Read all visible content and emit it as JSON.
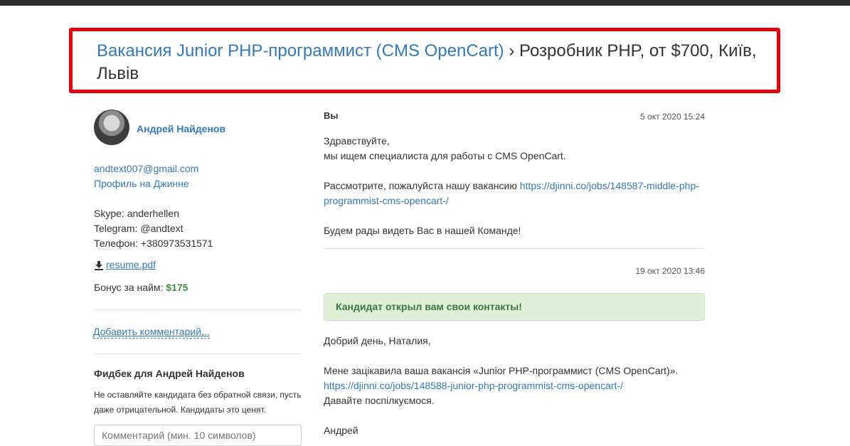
{
  "header": {
    "vacancy_link": "Вакансия Junior PHP-программист (CMS OpenCart)",
    "separator": "›",
    "subtitle": "Розробник PHP, от $700, Київ, Львів"
  },
  "candidate": {
    "name": "Андрей Найденов",
    "email": "andtext007@gmail.com",
    "profile_link": "Профиль на Джинне",
    "skype": "Skype: anderhellen",
    "telegram": "Telegram: @andtext",
    "phone": "Телефон: +380973531571",
    "resume": "resume.pdf",
    "bonus_label": "Бонус за найм: ",
    "bonus_value": "$175",
    "add_comment": "Добавить комментарий...",
    "feedback_title": "Фидбек для Андрей Найденов",
    "feedback_note": "Не оставляйте кандидата без обратной связи, пусть даже отрицательной. Кандидаты это ценят.",
    "comment_placeholder": "Комментарий (мин. 10 символов)"
  },
  "messages": [
    {
      "author": "Вы",
      "date": "5 окт 2020 15:24",
      "line1": "Здравствуйте,",
      "line2": "мы ищем специалиста для работы с CMS OpenCart.",
      "line3": "Рассмотрите, пожалуйста нашу вакансию ",
      "link": "https://djinni.co/jobs/148587-middle-php-programmist-cms-opencart-/",
      "line4": "Будем рады видеть Вас в нашей Команде!"
    },
    {
      "date": "19 окт 2020 13:46",
      "alert": "Кандидат открыл вам свои контакты!",
      "line1": "Добрий день, Наталия,",
      "line2": "Мене зацікавила ваша вакансія «Junior PHP-программист (CMS OpenCart)».",
      "link": "https://djinni.co/jobs/148588-junior-php-programmist-cms-opencart-/",
      "line3": "Давайте поспілкуємося.",
      "line4": "Андрей"
    }
  ],
  "colors": {
    "accent": "#337ab7",
    "highlight_border": "#e3000b",
    "success_bg": "#dff0d8",
    "success_text": "#3c763d",
    "bonus": "#3c8d3c"
  }
}
